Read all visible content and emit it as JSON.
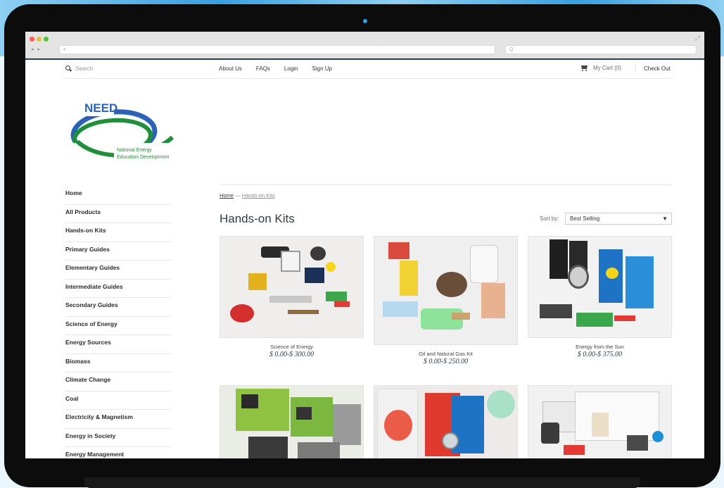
{
  "browser": {
    "url_placeholder": "+",
    "search_placeholder": "Q",
    "nav_arrows": "◂ ▸"
  },
  "topbar": {
    "search_placeholder": "Search",
    "links": [
      "About Us",
      "FAQs",
      "Login",
      "Sign Up"
    ],
    "cart_label": "My Cart (0)",
    "checkout_label": "Check Out"
  },
  "logo": {
    "brand": "NEED",
    "line1": "National Energy",
    "line2": "Education Development"
  },
  "sidebar": {
    "items": [
      "Home",
      "All Products",
      "Hands-on Kits",
      "Primary Guides",
      "Elementary Guides",
      "Intermediate Guides",
      "Secondary Guides",
      "Science of Energy",
      "Energy Sources",
      "Biomass",
      "Climate Change",
      "Coal",
      "Electricity & Magnetism",
      "Energy in Society",
      "Energy Management"
    ]
  },
  "breadcrumb": {
    "home": "Home",
    "sep": " — ",
    "current": "Hands-on Kits"
  },
  "page": {
    "title": "Hands-on Kits",
    "sort_label": "Sort by:",
    "sort_value": "Best Selling",
    "sort_arrow": "▼"
  },
  "products": [
    {
      "name": "Science of Energy",
      "price": "$ 0.00-$ 300.00"
    },
    {
      "name": "Oil and Natural Gas Kit",
      "price": "$ 0.00-$ 250.00"
    },
    {
      "name": "Energy from the Sun",
      "price": "$ 0.00-$ 375.00"
    },
    {
      "name": "",
      "price": ""
    },
    {
      "name": "",
      "price": ""
    },
    {
      "name": "",
      "price": ""
    }
  ],
  "colors": {
    "accent_dark": "#2d4659",
    "logo_blue": "#2a62b8",
    "logo_green": "#1f8f3a",
    "bg_blue": "#3a9fe0"
  }
}
